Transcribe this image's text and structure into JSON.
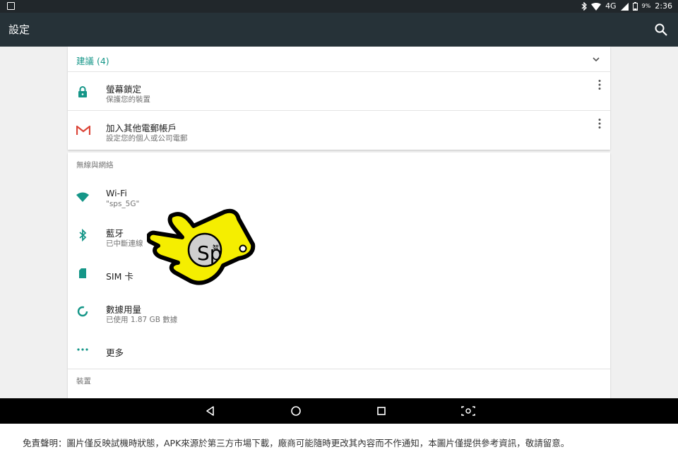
{
  "status_bar": {
    "network": "4G",
    "battery": "9%",
    "time": "2:36"
  },
  "app_bar": {
    "title": "設定",
    "search_icon": "search-icon"
  },
  "suggestions": {
    "header": "建議 (4)",
    "items": [
      {
        "icon": "lock-icon",
        "title": "螢幕鎖定",
        "subtitle": "保護您的裝置"
      },
      {
        "icon": "gmail-icon",
        "title": "加入其他電郵帳戶",
        "subtitle": "設定您的個人或公司電郵"
      }
    ]
  },
  "wireless": {
    "section_title": "無線與網絡",
    "items": [
      {
        "icon": "wifi-icon",
        "title": "Wi-Fi",
        "subtitle": "\"sps_5G\""
      },
      {
        "icon": "bluetooth-icon",
        "title": "藍牙",
        "subtitle": "已中斷連線"
      },
      {
        "icon": "sim-card-icon",
        "title": "SIM 卡",
        "subtitle": ""
      },
      {
        "icon": "data-usage-icon",
        "title": "數據用量",
        "subtitle": "已使用 1.87 GB 數據"
      },
      {
        "icon": "more-icon",
        "title": "更多",
        "subtitle": ""
      }
    ]
  },
  "device": {
    "section_title": "裝置"
  },
  "pointer_logo": {
    "letters": "Sp",
    "badge": "智"
  },
  "footer": {
    "disclaimer": "免責聲明：圖片僅反映試機時狀態，APK來源於第三方市場下載，廠商可能隨時更改其內容而不作通知，本圖片僅提供參考資訊，敬請留意。"
  },
  "colors": {
    "accent": "#159688",
    "app_bar": "#263238",
    "status_bar": "#21272b",
    "pointer_fill": "#f5ee00"
  }
}
